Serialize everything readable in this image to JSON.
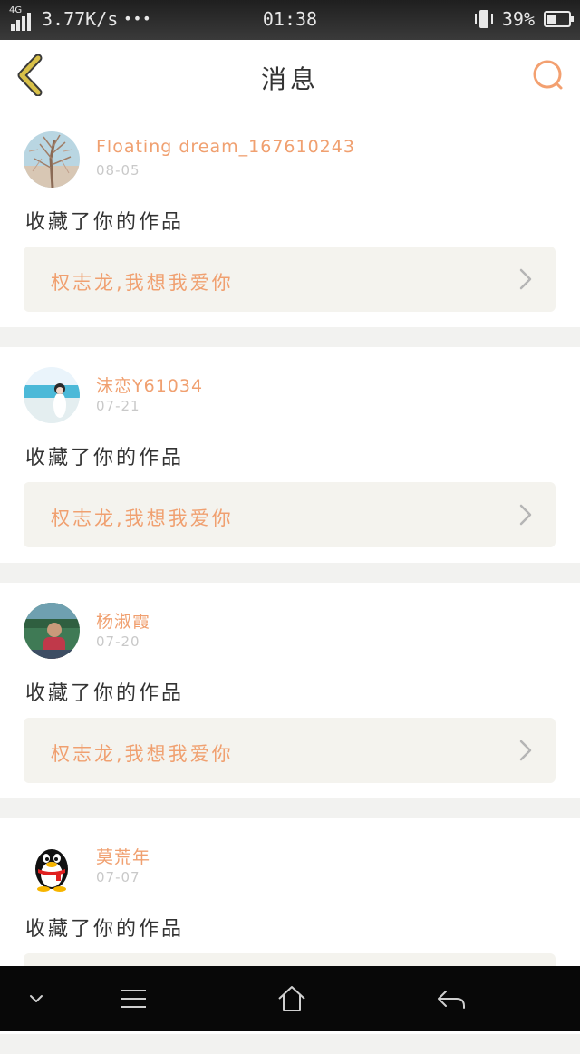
{
  "status_bar": {
    "network": "4G",
    "speed": "3.77K/s",
    "dots": "•••",
    "time": "01:38",
    "battery": "39%",
    "battery_level": 0.39
  },
  "header": {
    "title": "消息",
    "back_icon": "chevron-left-icon",
    "search_icon": "search-icon"
  },
  "colors": {
    "accent": "#f0a070",
    "back": "#d8c048",
    "search": "#f3a070",
    "card_bg": "#ffffff",
    "work_bg": "#f4f3ee"
  },
  "messages": [
    {
      "user": "Floating dream_167610243",
      "date": "08-05",
      "action": "收藏了你的作品",
      "work_title": "权志龙,我想我爱你",
      "avatar": "tree-photo"
    },
    {
      "user": "沫恋Y61034",
      "date": "07-21",
      "action": "收藏了你的作品",
      "work_title": "权志龙,我想我爱你",
      "avatar": "beach-girl-photo"
    },
    {
      "user": "杨淑霞",
      "date": "07-20",
      "action": "收藏了你的作品",
      "work_title": "权志龙,我想我爱你",
      "avatar": "child-photo"
    },
    {
      "user": "莫荒年",
      "date": "07-07",
      "action": "收藏了你的作品",
      "work_title": "",
      "avatar": "qq-penguin"
    }
  ],
  "nav": {
    "icons": [
      "chevron-down-icon",
      "menu-icon",
      "home-icon",
      "back-arrow-icon"
    ]
  }
}
